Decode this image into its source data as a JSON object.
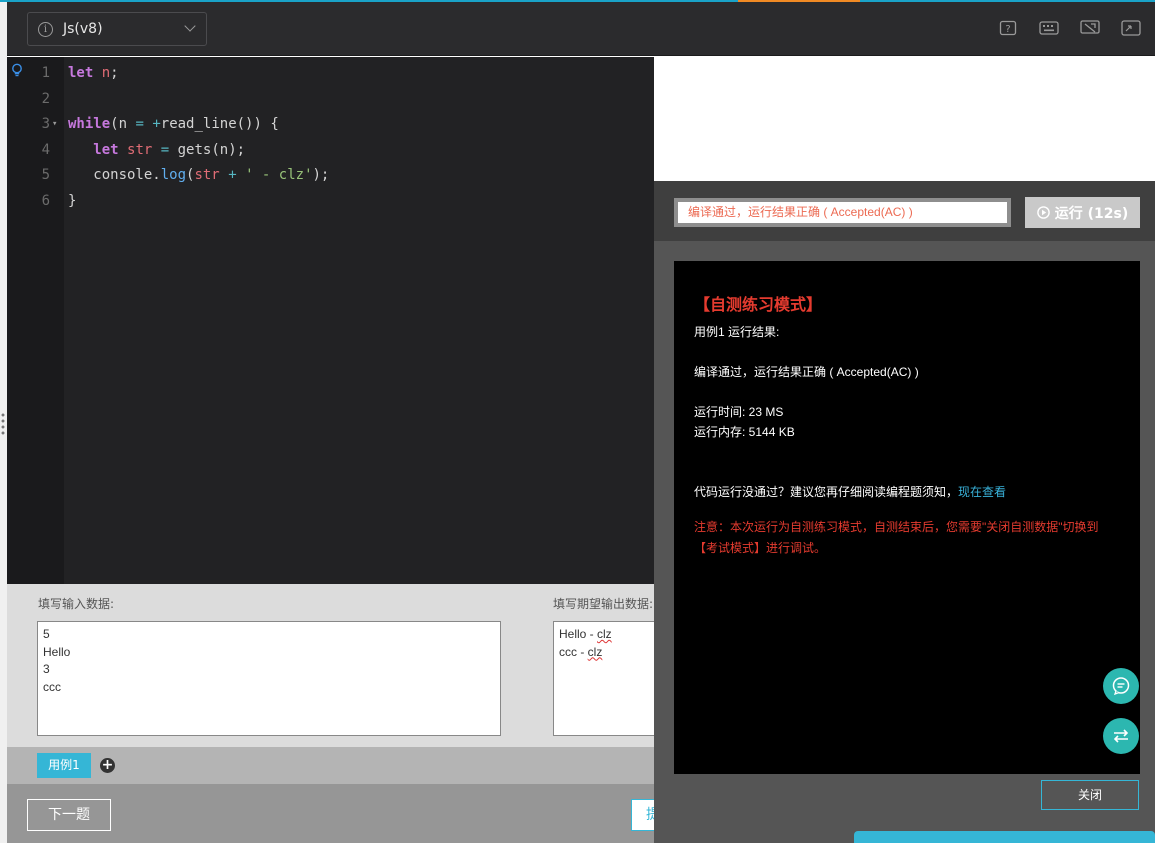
{
  "toolbar": {
    "language": "Js(v8)",
    "info_glyph": "i",
    "icons": [
      "help-icon",
      "keyboard-icon",
      "settings-icon",
      "fullscreen-icon"
    ]
  },
  "editor": {
    "lines": [
      {
        "num": "1",
        "tokens": [
          {
            "t": "let",
            "c": "kw"
          },
          {
            "t": " ",
            "c": "plain"
          },
          {
            "t": "n",
            "c": "var"
          },
          {
            "t": ";",
            "c": "plain"
          }
        ]
      },
      {
        "num": "2",
        "tokens": []
      },
      {
        "num": "3",
        "fold": "▾",
        "tokens": [
          {
            "t": "while",
            "c": "kw"
          },
          {
            "t": "(n ",
            "c": "plain"
          },
          {
            "t": "=",
            "c": "op"
          },
          {
            "t": " ",
            "c": "plain"
          },
          {
            "t": "+",
            "c": "op"
          },
          {
            "t": "read_line()) {",
            "c": "plain"
          }
        ]
      },
      {
        "num": "4",
        "tokens": [
          {
            "t": "   ",
            "c": "plain"
          },
          {
            "t": "let",
            "c": "kw"
          },
          {
            "t": " ",
            "c": "plain"
          },
          {
            "t": "str",
            "c": "var"
          },
          {
            "t": " ",
            "c": "plain"
          },
          {
            "t": "=",
            "c": "op"
          },
          {
            "t": " gets(n);",
            "c": "plain"
          }
        ]
      },
      {
        "num": "5",
        "tokens": [
          {
            "t": "   console.",
            "c": "plain"
          },
          {
            "t": "log",
            "c": "fn"
          },
          {
            "t": "(",
            "c": "plain"
          },
          {
            "t": "str",
            "c": "var"
          },
          {
            "t": " ",
            "c": "plain"
          },
          {
            "t": "+",
            "c": "op"
          },
          {
            "t": " ",
            "c": "plain"
          },
          {
            "t": "' - clz'",
            "c": "str"
          },
          {
            "t": ");",
            "c": "plain"
          }
        ]
      },
      {
        "num": "6",
        "tokens": [
          {
            "t": "}",
            "c": "plain"
          }
        ]
      }
    ]
  },
  "io": {
    "input_label": "填写输入数据:",
    "input_value": "5\nHello\n3\nccc",
    "expected_label": "填写期望输出数据:",
    "expected_lines": [
      [
        "Hello - ",
        "clz"
      ],
      [
        "ccc - ",
        "clz"
      ]
    ]
  },
  "cases": {
    "tab_label": "用例1",
    "add_glyph": "+"
  },
  "footer": {
    "next_label": "下一题",
    "hidden_btn_label": "提"
  },
  "result_panel": {
    "status_text": "编译通过，运行结果正确 ( Accepted(AC) )",
    "run_label": "运行 (12s)",
    "console": {
      "title": "【自测练习模式】",
      "case_result": "用例1 运行结果:",
      "verdict": "编译通过，运行结果正确 ( Accepted(AC) )",
      "time": "运行时间: 23 MS",
      "memory": "运行内存: 5144 KB",
      "hint_prefix": "代码运行没通过？建议您再仔细阅读编程题须知，",
      "hint_link": "现在查看",
      "warn_line1": "注意：本次运行为自测练习模式，自测结束后，您需要\"关闭自测数据\"切换到",
      "warn_line2": "【考试模式】进行调试。"
    },
    "close_label": "关闭",
    "fab_icons": [
      "chat-icon",
      "switch-icon"
    ]
  },
  "colors": {
    "accent": "#35b6d6",
    "error_red": "#e53b2f",
    "status_orange": "#ec6a52",
    "fab_teal": "#2cb7b0"
  }
}
